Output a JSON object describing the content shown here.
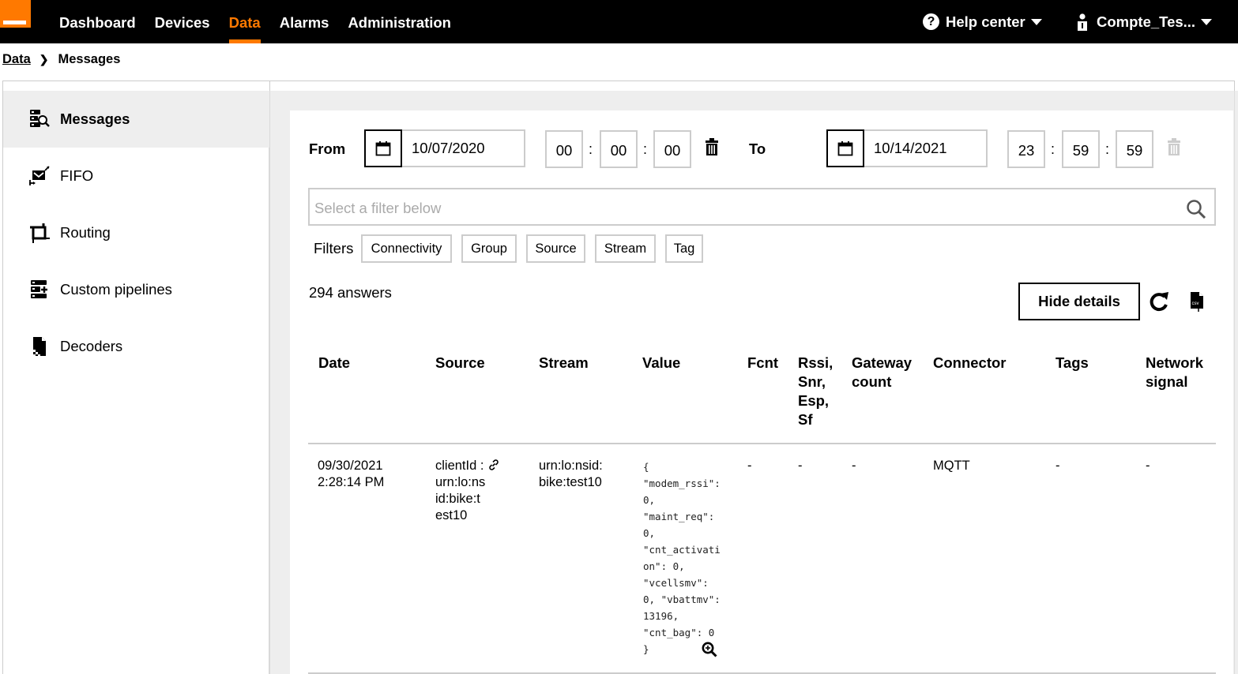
{
  "nav": {
    "items": [
      {
        "label": "Dashboard",
        "active": false
      },
      {
        "label": "Devices",
        "active": false
      },
      {
        "label": "Data",
        "active": true
      },
      {
        "label": "Alarms",
        "active": false
      },
      {
        "label": "Administration",
        "active": false
      }
    ],
    "help_label": "Help center",
    "account_label": "Compte_Tes...",
    "brand_color": "#ff7900"
  },
  "breadcrumb": {
    "parent": "Data",
    "current": "Messages"
  },
  "sidebar": {
    "items": [
      {
        "label": "Messages",
        "icon": "messages-search-icon",
        "active": true
      },
      {
        "label": "FIFO",
        "icon": "fifo-envelope-icon",
        "active": false
      },
      {
        "label": "Routing",
        "icon": "routing-icon",
        "active": false
      },
      {
        "label": "Custom pipelines",
        "icon": "pipeline-add-icon",
        "active": false
      },
      {
        "label": "Decoders",
        "icon": "decoder-file-icon",
        "active": false
      }
    ]
  },
  "date_filter": {
    "from_label": "From",
    "from_date": "10/07/2020",
    "from_time": {
      "h": "00",
      "m": "00",
      "s": "00"
    },
    "to_label": "To",
    "to_date": "10/14/2021",
    "to_time": {
      "h": "23",
      "m": "59",
      "s": "59"
    },
    "separator": ":"
  },
  "search": {
    "placeholder": "Select a filter below"
  },
  "filters": {
    "label": "Filters",
    "chips": [
      "Connectivity",
      "Group",
      "Source",
      "Stream",
      "Tag"
    ]
  },
  "results": {
    "count_text": "294 answers",
    "hide_details_label": "Hide details"
  },
  "table": {
    "headers": {
      "date": "Date",
      "source": "Source",
      "stream": "Stream",
      "value": "Value",
      "fcnt": "Fcnt",
      "rssi": "Rssi,\nSnr,\nEsp,\nSf",
      "gateway": "Gateway\ncount",
      "connector": "Connector",
      "tags": "Tags",
      "network": "Network\nsignal"
    },
    "rows": [
      {
        "date": "09/30/2021\n2:28:14 PM",
        "source_prefix": "clientId : ",
        "source": "urn:lo:ns\nid:bike:t\nest10",
        "stream": "urn:lo:nsid:\nbike:test10",
        "value": "{\n\"modem_rssi\":\n0,\n\"maint_req\":\n0,\n\"cnt_activati\non\": 0,\n\"vcellsmv\":\n0, \"vbattmv\":\n13196,\n\"cnt_bag\": 0\n}",
        "fcnt": "-",
        "rssi": "-",
        "gateway": "-",
        "connector": "MQTT",
        "tags": "-",
        "network": "-"
      }
    ]
  }
}
